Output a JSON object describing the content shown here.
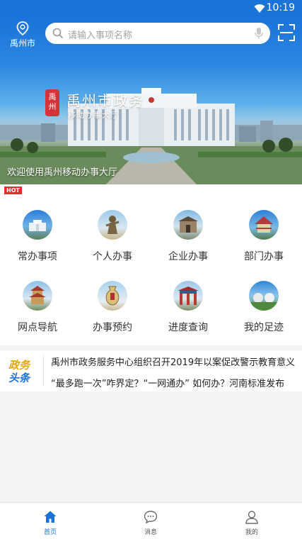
{
  "status_bar": {
    "time": "10:19"
  },
  "header": {
    "location": "禹州市",
    "search": {
      "placeholder": "请输入事项名称"
    }
  },
  "banner": {
    "seal": "禹州",
    "title": "禹州市政务",
    "subtitle": "移动办事大厅",
    "caption": "欢迎使用禹州移动办事大厅"
  },
  "services": {
    "hot_badge": "HOT",
    "items": [
      {
        "label": "常办事项",
        "icon": "building-icon"
      },
      {
        "label": "个人办事",
        "icon": "statue-icon"
      },
      {
        "label": "企业办事",
        "icon": "gate-icon"
      },
      {
        "label": "部门办事",
        "icon": "pavilion-icon"
      },
      {
        "label": "网点导航",
        "icon": "tower-icon"
      },
      {
        "label": "办事预约",
        "icon": "vase-icon"
      },
      {
        "label": "进度查询",
        "icon": "archway-icon"
      },
      {
        "label": "我的足迹",
        "icon": "park-icon"
      }
    ]
  },
  "news": {
    "logo_top": "政务",
    "logo_bottom": "头条",
    "items": [
      "禹州市政务服务中心组织召开2019年以案促改警示教育意义",
      "“最多跑一次”咋界定？“一网通办” 如何办？河南标准发布"
    ]
  },
  "tabbar": {
    "items": [
      {
        "label": "首页",
        "active": true
      },
      {
        "label": "消息",
        "active": false
      },
      {
        "label": "我的",
        "active": false
      }
    ]
  },
  "colors": {
    "primary": "#1a73d9",
    "hot": "#e62d2d",
    "logo_yellow": "#e6a400"
  }
}
